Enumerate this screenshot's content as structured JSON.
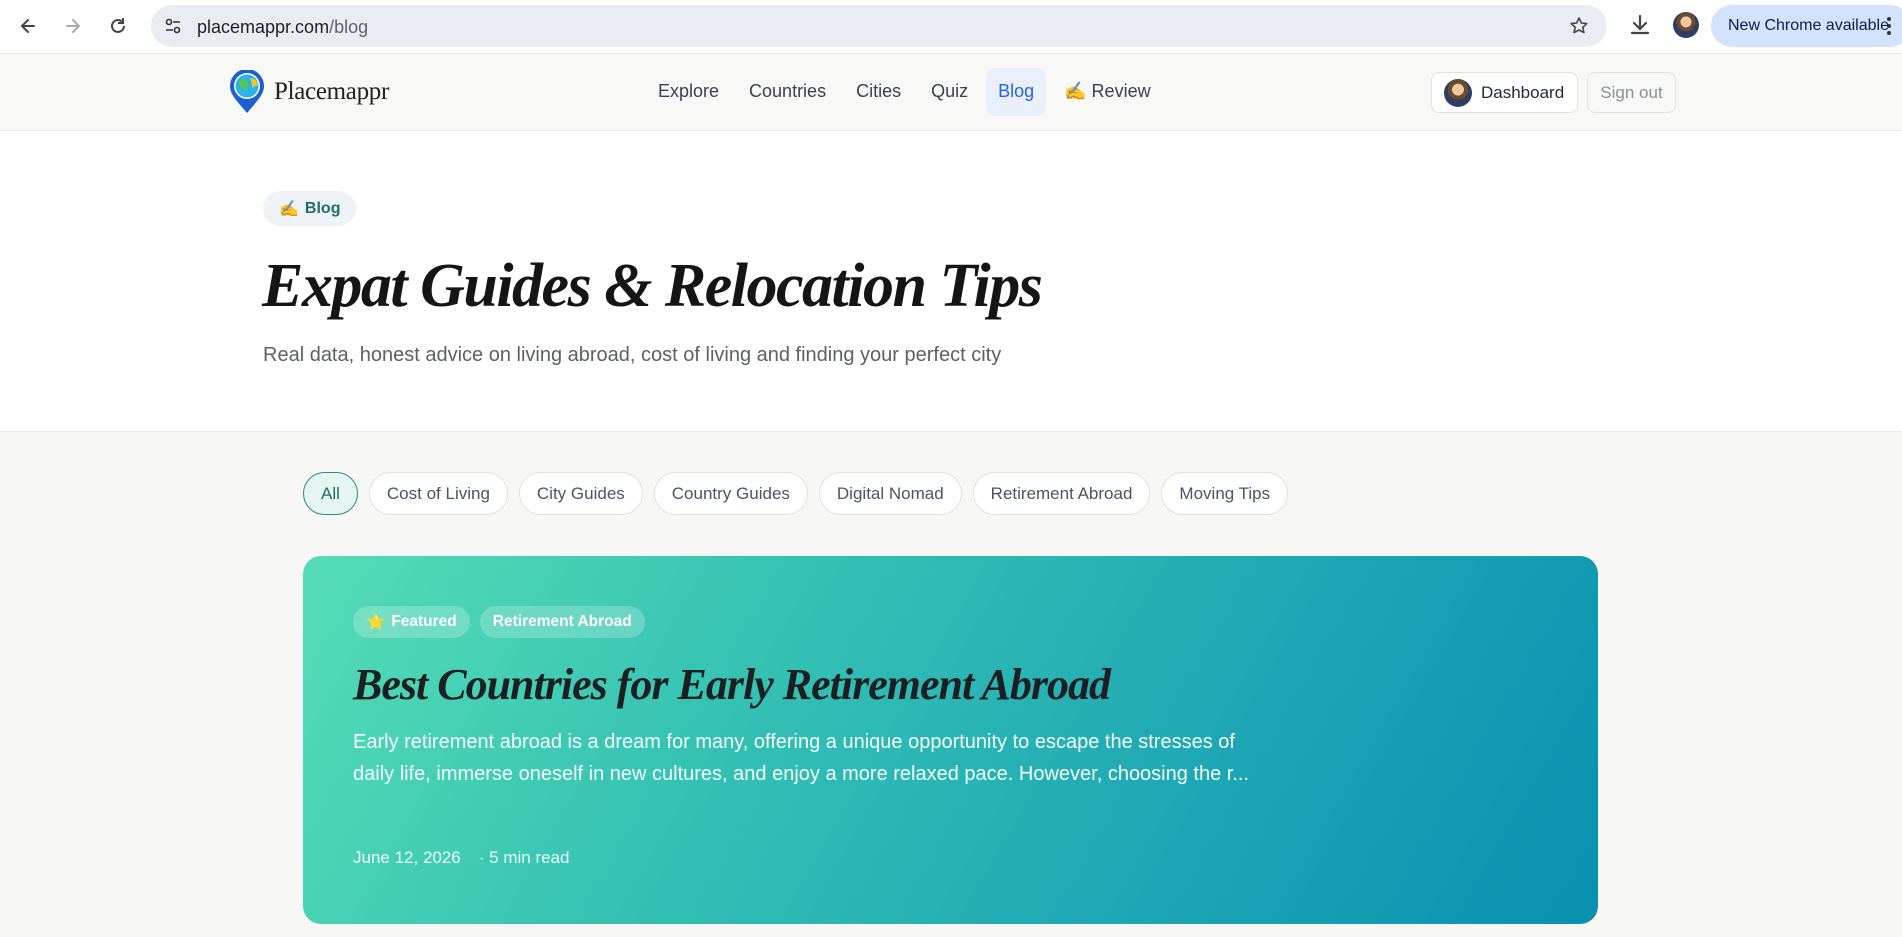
{
  "browser": {
    "url_host": "placemappr.com",
    "url_path": "/blog",
    "update_label": "New Chrome available"
  },
  "site": {
    "logo_text": "Placemappr",
    "nav": [
      {
        "label": "Explore"
      },
      {
        "label": "Countries"
      },
      {
        "label": "Cities"
      },
      {
        "label": "Quiz"
      },
      {
        "label": "Blog",
        "active": true
      },
      {
        "label": "✍️ Review"
      }
    ],
    "dashboard_label": "Dashboard",
    "signout_label": "Sign out"
  },
  "hero": {
    "badge_emoji": "✍️",
    "badge_label": "Blog",
    "title": "Expat Guides & Relocation Tips",
    "subtitle": "Real data, honest advice on living abroad, cost of living and finding your perfect city"
  },
  "filters": [
    "All",
    "Cost of Living",
    "City Guides",
    "Country Guides",
    "Digital Nomad",
    "Retirement Abroad",
    "Moving Tips"
  ],
  "featured": {
    "tag_featured_icon": "⭐",
    "tag_featured": "Featured",
    "tag_category": "Retirement Abroad",
    "title": "Best Countries for Early Retirement Abroad",
    "excerpt": "Early retirement abroad is a dream for many, offering a unique opportunity to escape the stresses of daily life, immerse oneself in new cultures, and enjoy a more relaxed pace. However, choosing the r...",
    "date": "June 12, 2026",
    "read_time": "· 5 min read"
  },
  "colors": {
    "accent": "#2563eb",
    "teal": "#1e6f67",
    "gradient_start": "#56ddb5",
    "gradient_end": "#0990b0"
  }
}
